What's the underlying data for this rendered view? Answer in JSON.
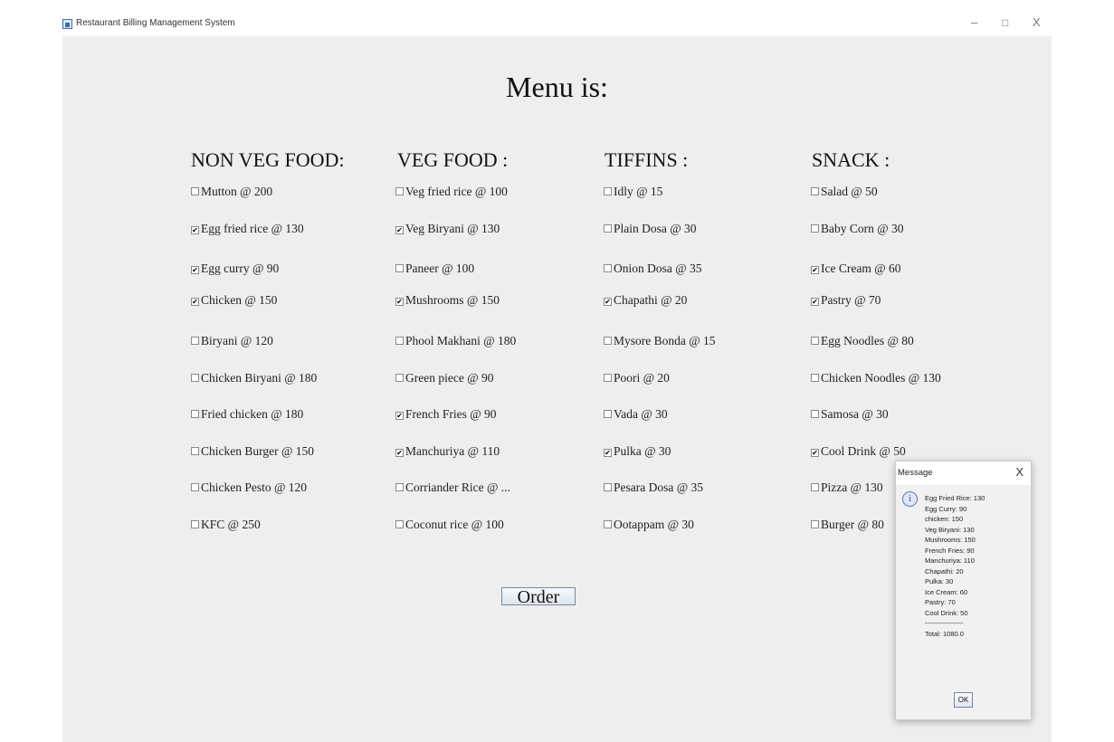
{
  "window": {
    "title": "Restaurant Billing Management System",
    "minimize": "–",
    "maximize": "□",
    "close": "X"
  },
  "menu_title": "Menu is:",
  "columns": [
    {
      "heading": "NON VEG FOOD:",
      "items": [
        {
          "label": "Mutton @ 200",
          "checked": false
        },
        {
          "label": "Egg fried rice @ 130",
          "checked": true
        },
        {
          "label": "Egg curry @ 90",
          "checked": true
        },
        {
          "label": "Chicken @ 150",
          "checked": true
        },
        {
          "label": "Biryani @ 120",
          "checked": false
        },
        {
          "label": "Chicken Biryani @ 180",
          "checked": false
        },
        {
          "label": "Fried chicken @ 180",
          "checked": false
        },
        {
          "label": "Chicken Burger @ 150",
          "checked": false
        },
        {
          "label": "Chicken Pesto @ 120",
          "checked": false
        },
        {
          "label": "KFC @ 250",
          "checked": false
        }
      ]
    },
    {
      "heading": "VEG FOOD :",
      "items": [
        {
          "label": "Veg fried rice @ 100",
          "checked": false
        },
        {
          "label": "Veg Biryani @ 130",
          "checked": true
        },
        {
          "label": "Paneer @ 100",
          "checked": false
        },
        {
          "label": "Mushrooms @ 150",
          "checked": true
        },
        {
          "label": "Phool Makhani @ 180",
          "checked": false
        },
        {
          "label": "Green piece @ 90",
          "checked": false
        },
        {
          "label": "French Fries @ 90",
          "checked": true
        },
        {
          "label": "Manchuriya @ 110",
          "checked": true
        },
        {
          "label": "Corriander Rice @ ...",
          "checked": false
        },
        {
          "label": "Coconut rice @ 100",
          "checked": false
        }
      ]
    },
    {
      "heading": "TIFFINS :",
      "items": [
        {
          "label": "Idly @ 15",
          "checked": false
        },
        {
          "label": "Plain Dosa @ 30",
          "checked": false
        },
        {
          "label": "Onion Dosa @ 35",
          "checked": false
        },
        {
          "label": "Chapathi @ 20",
          "checked": true
        },
        {
          "label": "Mysore Bonda @ 15",
          "checked": false
        },
        {
          "label": "Poori @ 20",
          "checked": false
        },
        {
          "label": "Vada @ 30",
          "checked": false
        },
        {
          "label": "Pulka @ 30",
          "checked": true
        },
        {
          "label": "Pesara Dosa @ 35",
          "checked": false
        },
        {
          "label": "Ootappam @ 30",
          "checked": false
        }
      ]
    },
    {
      "heading": "SNACK :",
      "items": [
        {
          "label": "Salad @ 50",
          "checked": false
        },
        {
          "label": "Baby Corn @ 30",
          "checked": false
        },
        {
          "label": "Ice Cream @ 60",
          "checked": true
        },
        {
          "label": "Pastry @ 70",
          "checked": true
        },
        {
          "label": "Egg Noodles @ 80",
          "checked": false
        },
        {
          "label": "Chicken Noodles @ 130",
          "checked": false
        },
        {
          "label": "Samosa @ 30",
          "checked": false
        },
        {
          "label": "Cool Drink @ 50",
          "checked": true
        },
        {
          "label": "Pizza @ 130",
          "checked": false
        },
        {
          "label": "Burger @ 80",
          "checked": false
        }
      ]
    }
  ],
  "order_button": "Order",
  "dialog": {
    "title": "Message",
    "close": "X",
    "icon": "info-icon",
    "icon_glyph": "i",
    "lines": [
      "Egg Fried Rice: 130",
      "Egg Curry: 90",
      "chicken: 150",
      "Veg Biryani: 130",
      "Mushrooms: 150",
      "French Fries: 90",
      "Manchuriya: 110",
      "Chapathi: 20",
      "Pulka: 30",
      "Ice Cream: 60",
      "Pastry: 70",
      "Cool Drink: 50",
      "-----------------",
      "Total: 1080.0"
    ],
    "ok": "OK"
  },
  "colors": {
    "content_bg": "#eeeeee",
    "window_bg": "#ffffff",
    "dialog_bg": "#f1f1f1"
  }
}
